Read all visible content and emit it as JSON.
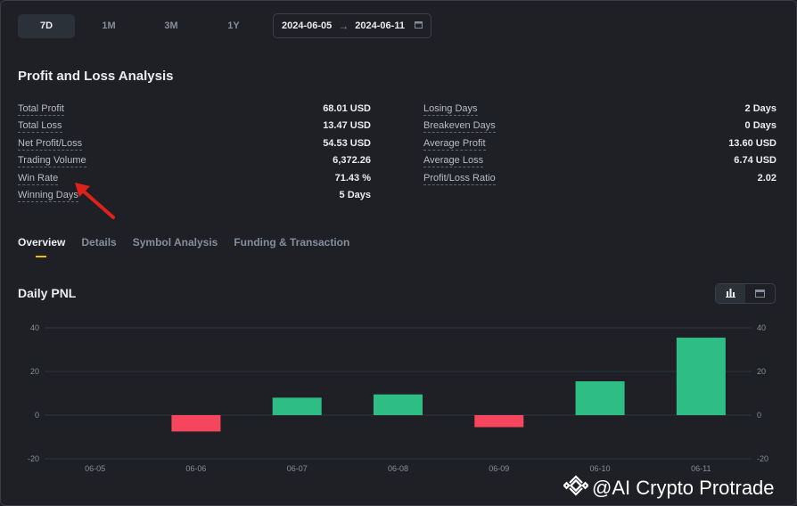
{
  "periods": [
    {
      "label": "7D",
      "active": true
    },
    {
      "label": "1M",
      "active": false
    },
    {
      "label": "3M",
      "active": false
    },
    {
      "label": "1Y",
      "active": false
    }
  ],
  "date_range": {
    "start": "2024-06-05",
    "end": "2024-06-11"
  },
  "analysis": {
    "title": "Profit and Loss Analysis",
    "left": [
      {
        "label": "Total Profit",
        "value": "68.01 USD"
      },
      {
        "label": "Total Loss",
        "value": "13.47 USD"
      },
      {
        "label": "Net Profit/Loss",
        "value": "54.53 USD"
      },
      {
        "label": "Trading Volume",
        "value": "6,372.26"
      },
      {
        "label": "Win Rate",
        "value": "71.43 %"
      },
      {
        "label": "Winning Days",
        "value": "5 Days"
      }
    ],
    "right": [
      {
        "label": "Losing Days",
        "value": "2 Days"
      },
      {
        "label": "Breakeven Days",
        "value": "0 Days"
      },
      {
        "label": "Average Profit",
        "value": "13.60 USD"
      },
      {
        "label": "Average Loss",
        "value": "6.74 USD"
      },
      {
        "label": "Profit/Loss Ratio",
        "value": "2.02"
      }
    ]
  },
  "tabs": [
    {
      "label": "Overview",
      "active": true
    },
    {
      "label": "Details",
      "active": false
    },
    {
      "label": "Symbol Analysis",
      "active": false
    },
    {
      "label": "Funding & Transaction",
      "active": false
    }
  ],
  "daily_pnl": {
    "title": "Daily PNL",
    "active_view": "bar-chart"
  },
  "colors": {
    "positive": "#2ebd85",
    "negative": "#f6465d",
    "accent": "#f0b90b",
    "annotation": "#e0201b"
  },
  "icons": [
    "calendar-icon",
    "bar-chart-icon",
    "calendar-icon",
    "annotation-arrow",
    "binance-logo-icon"
  ],
  "watermark": "@AI Crypto Protrade",
  "chart_data": {
    "type": "bar",
    "categories": [
      "06-05",
      "06-06",
      "06-07",
      "06-08",
      "06-09",
      "06-10",
      "06-11"
    ],
    "values": [
      0,
      -7.5,
      8,
      9.5,
      -5.5,
      15.5,
      35.5
    ],
    "yticks": [
      40,
      20,
      0,
      -20
    ],
    "ylim": [
      -20,
      40
    ],
    "grid": true,
    "right_axis": true
  }
}
